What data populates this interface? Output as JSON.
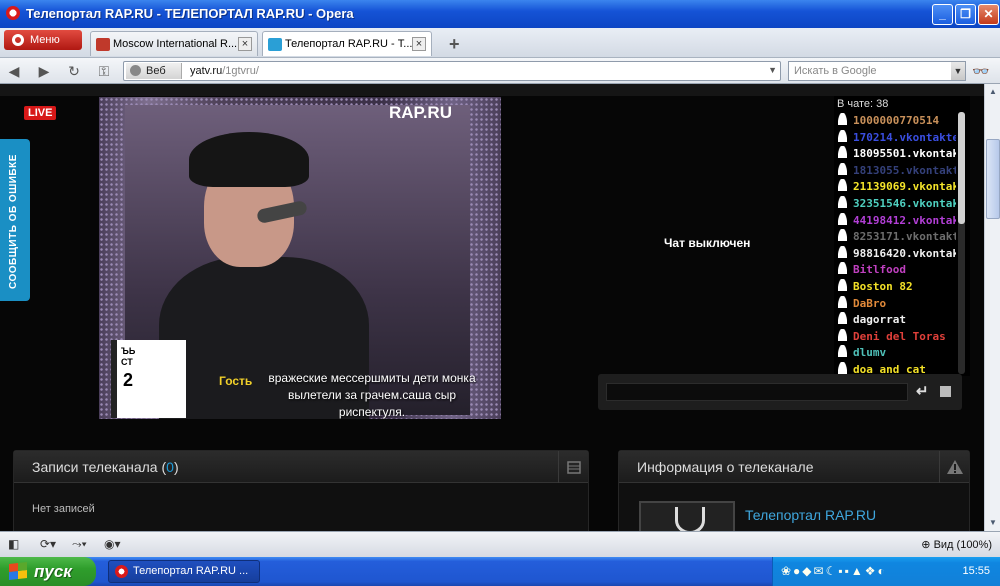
{
  "window": {
    "title": "Телепортал RAP.RU - ТЕЛЕПОРТАЛ RAP.RU - Opera",
    "minimize_glyph": "_",
    "maximize_glyph": "❐",
    "close_glyph": "✕"
  },
  "browser": {
    "menu_label": "Меню",
    "tabs": [
      {
        "label": "Moscow International R...",
        "favicon_color": "#c0392b",
        "active": false
      },
      {
        "label": "Телепортал RAP.RU - Т...",
        "favicon_color": "#2a9fd6",
        "active": true
      }
    ],
    "new_tab_glyph": "+",
    "tab_close_glyph": "×",
    "web_label": "Веб",
    "url_main": "yatv.ru",
    "url_path": "/1gtvru/",
    "search_placeholder": "Искать в Google",
    "dropdown_glyph": "▼"
  },
  "nav_icons": {
    "back": "◀",
    "forward": "▶",
    "reload": "↻",
    "key": "⚿",
    "binoculars": "👓"
  },
  "page": {
    "live_label": "LIVE",
    "report_tab": "СООБЩИТЬ ОБ ОШИБКЕ",
    "video": {
      "logo": "RAP.RU",
      "graphic_lines": "ЪЬ\nСТ",
      "graphic_number": "2",
      "ticker_guest": "Гость",
      "ticker_text": "вражеские мессершмиты дети монка вылетели за грачем.саша сыр риспектуля."
    },
    "chat_disabled": "Чат выключен",
    "chat": {
      "in_chat_label": "В чате: 38",
      "send_glyph": "↵",
      "users": [
        {
          "name": "1000000770514",
          "color": "#c8905a"
        },
        {
          "name": "170214.vkontakte",
          "color": "#3a4ee0"
        },
        {
          "name": "18095501.vkontakte",
          "color": "#ffffff"
        },
        {
          "name": "1813055.vkontakte",
          "color": "#34407a"
        },
        {
          "name": "21139069.vkontakte",
          "color": "#f5e52a"
        },
        {
          "name": "32351546.vkontakte",
          "color": "#4fd0c0"
        },
        {
          "name": "44198412.vkontakte",
          "color": "#b23fd6"
        },
        {
          "name": "8253171.vkontakte",
          "color": "#6d6d6d"
        },
        {
          "name": "98816420.vkontakte",
          "color": "#f0f0f0"
        },
        {
          "name": "Bitlfood",
          "color": "#c040c0"
        },
        {
          "name": "Boston 82",
          "color": "#f2e027"
        },
        {
          "name": "DaBro",
          "color": "#e0893a"
        },
        {
          "name": "dagorrat",
          "color": "#f0f0f0"
        },
        {
          "name": "Deni del Toras",
          "color": "#e0403a"
        },
        {
          "name": "dlumv",
          "color": "#4fc0b8"
        },
        {
          "name": "doa_and_cat",
          "color": "#f2e027"
        }
      ]
    },
    "panels": {
      "records": {
        "title": "Записи телеканала",
        "count_open": "(",
        "count": "0",
        "count_close": ")",
        "empty": "Нет записей"
      },
      "info": {
        "title": "Информация о телеканале",
        "channel_name": "Телепортал RAP.RU",
        "warn_glyph": "▲"
      }
    }
  },
  "statusbar": {
    "panel_glyph": "◧",
    "sync_glyph": "⟳▾",
    "turbo_glyph": "⤳▾",
    "unite_glyph": "◉▾",
    "zoom": "Вид (100%)"
  },
  "taskbar": {
    "start_label": "пуск",
    "task_label": "Телепортал RAP.RU ...",
    "tray_icons": "❀●◆✉☾▪▪▲❖◐",
    "clock": "15:55"
  }
}
